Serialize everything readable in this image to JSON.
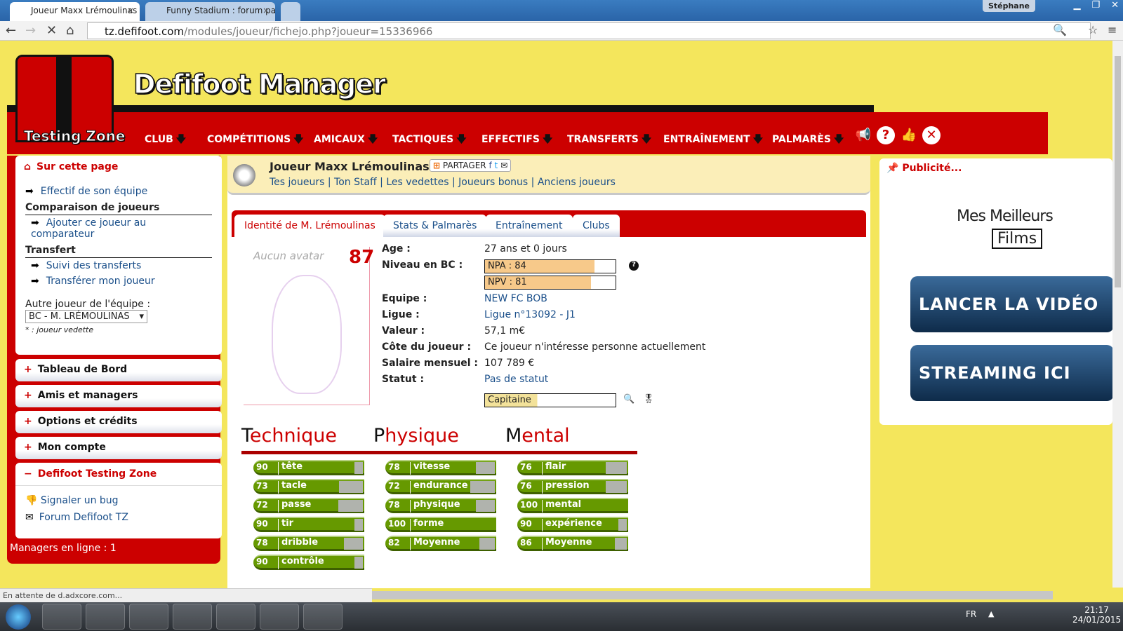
{
  "browser": {
    "tabs": [
      {
        "title": "Joueur Maxx Lrémoulinas",
        "active": true
      },
      {
        "title": "Funny Stadium : forum pa",
        "active": false
      }
    ],
    "user": "Stéphane",
    "url_domain": "tz.defifoot.com",
    "url_path": "/modules/joueur/fichejo.php?joueur=15336966",
    "status": "En attente de d.adxcore.com..."
  },
  "header": {
    "title": "Defifoot Manager",
    "zone": "Testing Zone",
    "menu": [
      "CLUB",
      "COMPÉTITIONS",
      "AMICAUX",
      "TACTIQUES",
      "EFFECTIFS",
      "TRANSFERTS",
      "ENTRAÎNEMENT",
      "PALMARÈS"
    ],
    "arrow": "🡇"
  },
  "sidebar": {
    "title": "Sur cette page",
    "links": {
      "effectif": "Effectif de son équipe",
      "comparaison": "Comparaison de joueurs",
      "ajouter": "Ajouter ce joueur au comparateur",
      "transfert": "Transfert",
      "suivi": "Suivi des transferts",
      "transferer": "Transférer mon joueur"
    },
    "autre_label": "Autre joueur de l'équipe :",
    "autre_value": "BC - M. LRÉMOULINAS",
    "vedette_note": "* : joueur vedette",
    "sections": [
      "Tableau de Bord",
      "Amis et managers",
      "Options et crédits",
      "Mon compte"
    ],
    "open_section": "Defifoot Testing Zone",
    "bug": "Signaler un bug",
    "forum": "Forum Defifoot TZ",
    "online": "Managers en ligne : 1"
  },
  "player": {
    "title": "Joueur Maxx Lrémoulinas",
    "share": "PARTAGER",
    "nav": [
      "Tes joueurs",
      "Ton Staff",
      "Les vedettes",
      "Joueurs bonus",
      "Anciens joueurs"
    ],
    "tabs": [
      "Identité de M. Lrémoulinas",
      "Stats & Palmarès",
      "Entraînement",
      "Clubs"
    ],
    "avatar_text": "Aucun avatar",
    "rating": "87",
    "fields": {
      "age_l": "Age :",
      "age": "27 ans et 0 jours",
      "niveau_l": "Niveau en BC :",
      "npa": "NPA : 84",
      "npa_pct": 84,
      "npv": "NPV : 81",
      "npv_pct": 81,
      "equipe_l": "Equipe :",
      "equipe": "NEW FC BOB",
      "ligue_l": "Ligue :",
      "ligue": "Ligue n°13092 - J1",
      "valeur_l": "Valeur :",
      "valeur": "57,1 m€",
      "cote_l": "Côte du joueur :",
      "cote": "Ce joueur n'intéresse personne actuellement",
      "salaire_l": "Salaire mensuel :",
      "salaire": "107 789 €",
      "statut_l": "Statut :",
      "statut": "Pas de statut",
      "role": "Capitaine"
    }
  },
  "stats": [
    {
      "first": "T",
      "rest": "echnique",
      "items": [
        {
          "v": 90,
          "l": "tête"
        },
        {
          "v": 73,
          "l": "tacle"
        },
        {
          "v": 72,
          "l": "passe"
        },
        {
          "v": 90,
          "l": "tir"
        },
        {
          "v": 78,
          "l": "dribble"
        },
        {
          "v": 90,
          "l": "contrôle"
        }
      ]
    },
    {
      "first": "P",
      "rest": "hysique",
      "items": [
        {
          "v": 78,
          "l": "vitesse"
        },
        {
          "v": 72,
          "l": "endurance"
        },
        {
          "v": 78,
          "l": "physique"
        },
        {
          "v": 100,
          "l": "forme"
        },
        {
          "v": 82,
          "l": "Moyenne"
        }
      ]
    },
    {
      "first": "M",
      "rest": "ental",
      "items": [
        {
          "v": 76,
          "l": "flair"
        },
        {
          "v": 76,
          "l": "pression"
        },
        {
          "v": 100,
          "l": "mental"
        },
        {
          "v": 90,
          "l": "expérience"
        },
        {
          "v": 86,
          "l": "Moyenne"
        }
      ]
    }
  ],
  "ad": {
    "title": "Publicité...",
    "brand1": "Mes Meilleurs",
    "brand2": "Films",
    "btn1": "LANCER LA VIDÉO",
    "btn2": "STREAMING ICI"
  },
  "taskbar": {
    "lang": "FR",
    "time": "21:17",
    "date": "24/01/2015"
  },
  "colors": {
    "red": "#cc0000",
    "yellow": "#f4e65c",
    "bar_green": "#669900"
  }
}
